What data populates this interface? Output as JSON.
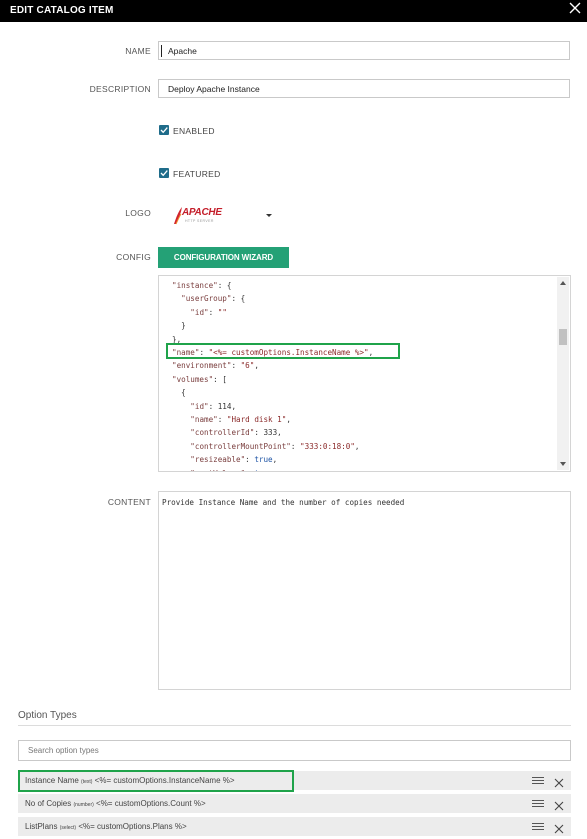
{
  "dialog": {
    "title": "EDIT CATALOG ITEM"
  },
  "form": {
    "name_label": "NAME",
    "name_value": "Apache",
    "description_label": "DESCRIPTION",
    "description_value": "Deploy Apache Instance",
    "enabled_label": "ENABLED",
    "enabled_checked": true,
    "featured_label": "FEATURED",
    "featured_checked": true,
    "logo_label": "LOGO",
    "logo_text": "APACHE",
    "logo_subtext": "HTTP SERVER",
    "config_label": "CONFIG",
    "wizard_button": "CONFIGURATION WIZARD",
    "content_label": "CONTENT",
    "content_value": "Provide Instance Name and the number of copies needed"
  },
  "config_code": [
    {
      "parts": [
        [
          "k",
          "\"instance\""
        ],
        [
          "n",
          ": {"
        ]
      ]
    },
    {
      "parts": [
        [
          "n",
          "  "
        ],
        [
          "k",
          "\"userGroup\""
        ],
        [
          "n",
          ": {"
        ]
      ]
    },
    {
      "parts": [
        [
          "n",
          "    "
        ],
        [
          "k",
          "\"id\""
        ],
        [
          "n",
          ": "
        ],
        [
          "s",
          "\"\""
        ]
      ]
    },
    {
      "parts": [
        [
          "n",
          "  }"
        ]
      ]
    },
    {
      "parts": [
        [
          "n",
          "},"
        ]
      ]
    },
    {
      "parts": [
        [
          "k",
          "\"name\""
        ],
        [
          "n",
          ": "
        ],
        [
          "s",
          "\"<%= customOptions.InstanceName %>\""
        ],
        [
          "n",
          ","
        ]
      ]
    },
    {
      "parts": [
        [
          "k",
          "\"environment\""
        ],
        [
          "n",
          ": "
        ],
        [
          "s",
          "\"6\""
        ],
        [
          "n",
          ","
        ]
      ]
    },
    {
      "parts": [
        [
          "k",
          "\"volumes\""
        ],
        [
          "n",
          ": ["
        ]
      ]
    },
    {
      "parts": [
        [
          "n",
          "  {"
        ]
      ]
    },
    {
      "parts": [
        [
          "n",
          "    "
        ],
        [
          "k",
          "\"id\""
        ],
        [
          "n",
          ": 114,"
        ]
      ]
    },
    {
      "parts": [
        [
          "n",
          "    "
        ],
        [
          "k",
          "\"name\""
        ],
        [
          "n",
          ": "
        ],
        [
          "s",
          "\"Hard disk 1\""
        ],
        [
          "n",
          ","
        ]
      ]
    },
    {
      "parts": [
        [
          "n",
          "    "
        ],
        [
          "k",
          "\"controllerId\""
        ],
        [
          "n",
          ": 333,"
        ]
      ]
    },
    {
      "parts": [
        [
          "n",
          "    "
        ],
        [
          "k",
          "\"controllerMountPoint\""
        ],
        [
          "n",
          ": "
        ],
        [
          "s",
          "\"333:0:18:0\""
        ],
        [
          "n",
          ","
        ]
      ]
    },
    {
      "parts": [
        [
          "n",
          "    "
        ],
        [
          "k",
          "\"resizeable\""
        ],
        [
          "n",
          ": "
        ],
        [
          "b",
          "true"
        ],
        [
          "n",
          ","
        ]
      ]
    },
    {
      "parts": [
        [
          "n",
          "    "
        ],
        [
          "k",
          "\"rootVolume\""
        ],
        [
          "n",
          ": "
        ],
        [
          "b",
          "true"
        ],
        [
          "n",
          ","
        ]
      ]
    }
  ],
  "option_types": {
    "title": "Option Types",
    "search_placeholder": "Search option types",
    "items": [
      {
        "name": "Instance Name",
        "type": "(text)",
        "expr": "<%= customOptions.InstanceName %>"
      },
      {
        "name": "No of Copies",
        "type": "(number)",
        "expr": "<%= customOptions.Count %>"
      },
      {
        "name": "ListPlans",
        "type": "(select)",
        "expr": "<%= customOptions.Plans %>"
      }
    ]
  },
  "colors": {
    "accent_green": "#24a176",
    "highlight_green": "#1fa34a",
    "checkbox_blue": "#1f6c8a"
  },
  "icons": [
    "close-icon",
    "check-icon",
    "chevron-down-icon",
    "drag-handle-icon",
    "remove-icon"
  ]
}
